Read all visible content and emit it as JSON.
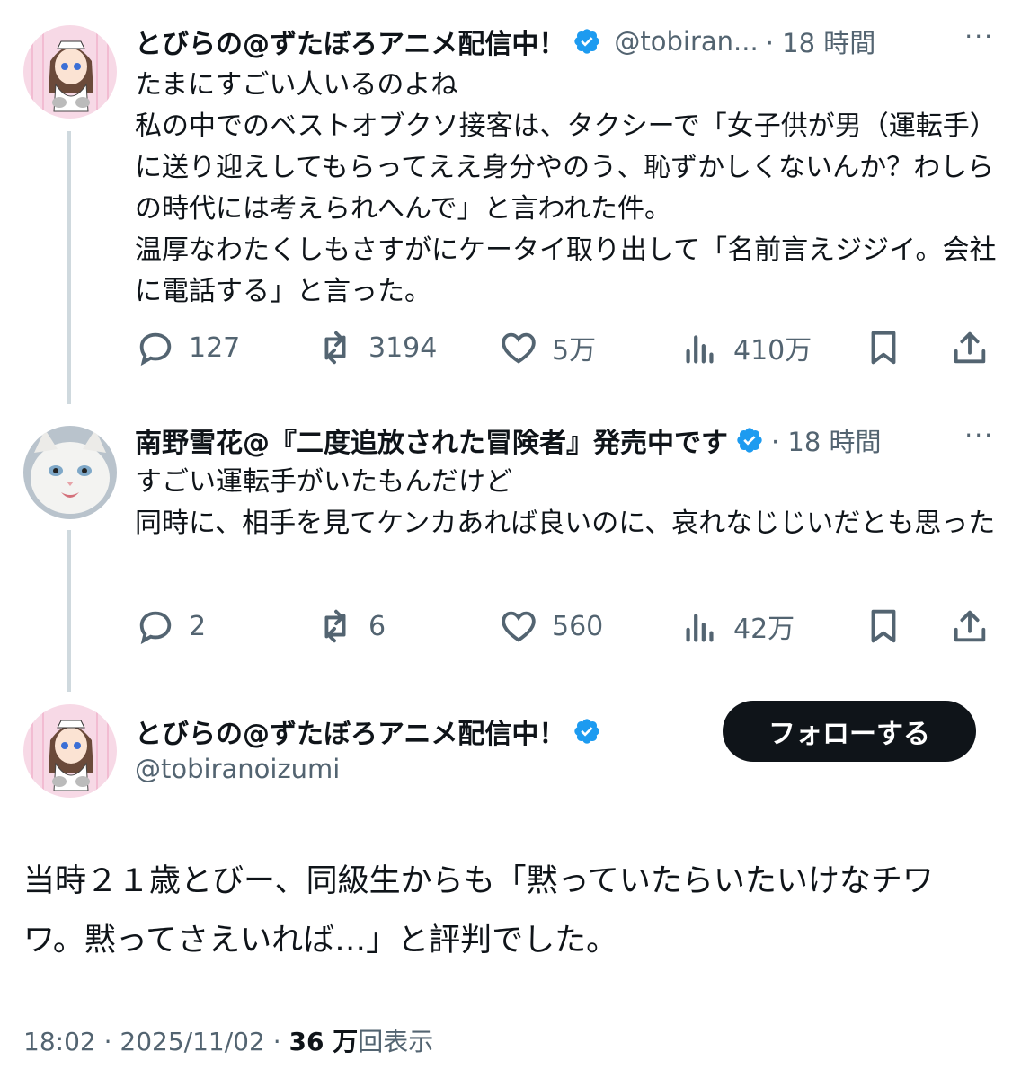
{
  "tweets": [
    {
      "name": "とびらの@ずたぼろアニメ配信中！",
      "handle": "@tobiran...",
      "time": "· 18 時間",
      "more": "···",
      "text": "たまにすごい人いるのよね\n私の中でのベストオブクソ接客は、タクシーで「女子供が男（運転手）に送り迎えしてもらってええ身分やのう、恥ずかしくないんか？わしらの時代には考えられへんで」と言われた件。\n温厚なわたくしもさすがにケータイ取り出して「名前言えジジイ。会社に電話する」と言った。",
      "replies": "127",
      "reposts": "3194",
      "likes": "5万",
      "views": "410万"
    },
    {
      "name": "南野雪花@『二度追放された冒険者』発売中です",
      "time": "· 18 時間",
      "more": "···",
      "text": "すごい運転手がいたもんだけど\n同時に、相手を見てケンカあれば良いのに、哀れなじじいだとも思った",
      "replies": "2",
      "reposts": "6",
      "likes": "560",
      "views": "42万"
    }
  ],
  "main": {
    "name": "とびらの@ずたぼろアニメ配信中！",
    "handle": "@tobiranoizumi",
    "follow_label": "フォローする",
    "text": "当時２１歳とびー、同級生からも「黙っていたらいたいけなチワワ。黙ってさえいれば…」と評判でした。",
    "time": "18:02",
    "date": "2025/11/02",
    "views": "36 万",
    "views_suffix": "回表示"
  },
  "colors": {
    "verified": "#1d9bf0",
    "muted": "#536471",
    "text": "#0f1419",
    "thread_line": "#cfd9de"
  }
}
